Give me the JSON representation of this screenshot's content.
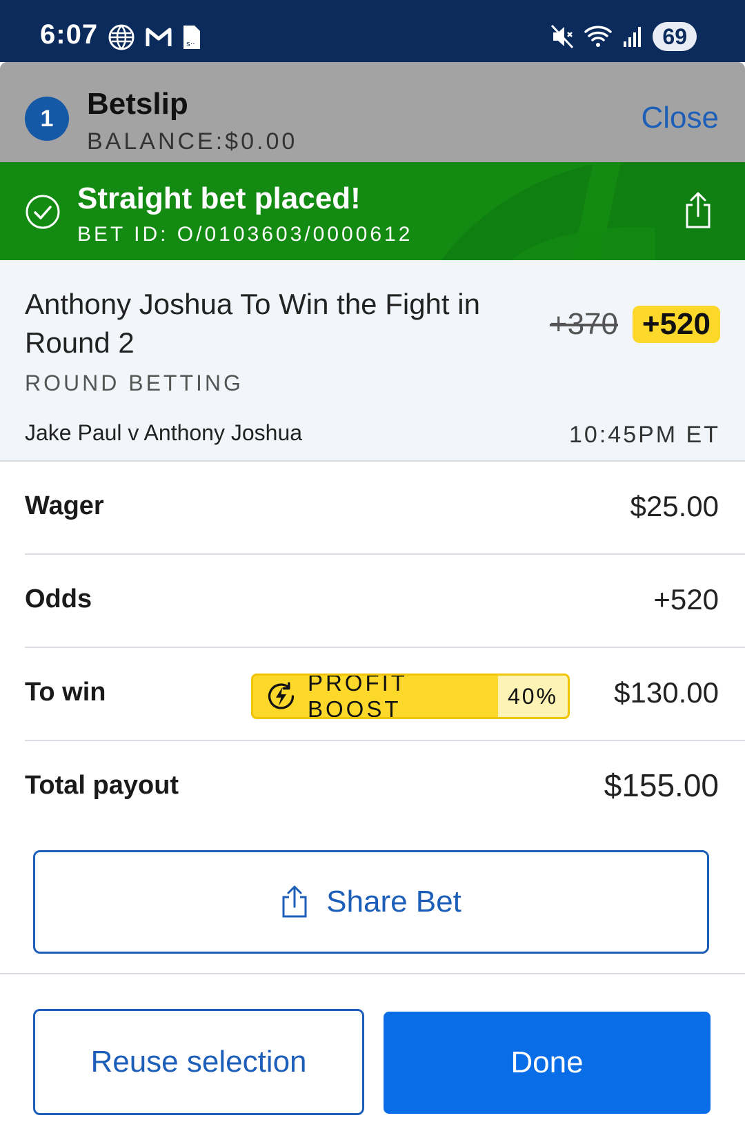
{
  "status_bar": {
    "time": "6:07",
    "battery": "69"
  },
  "header": {
    "count": "1",
    "title": "Betslip",
    "balance": "BALANCE:$0.00",
    "close_label": "Close"
  },
  "banner": {
    "title": "Straight bet placed!",
    "bet_id": "BET ID: O/0103603/0000612"
  },
  "selection": {
    "title": "Anthony Joshua To Win the Fight in Round 2",
    "market": "ROUND BETTING",
    "old_odds": "+370",
    "new_odds": "+520",
    "event": "Jake Paul v Anthony Joshua",
    "time": "10:45PM ET"
  },
  "summary": {
    "wager_label": "Wager",
    "wager_value": "$25.00",
    "odds_label": "Odds",
    "odds_value": "+520",
    "to_win_label": "To win",
    "to_win_value": "$130.00",
    "boost_label": "PROFIT BOOST",
    "boost_pct": "40%",
    "payout_label": "Total payout",
    "payout_value": "$155.00"
  },
  "buttons": {
    "share": "Share Bet",
    "reuse": "Reuse selection",
    "done": "Done"
  },
  "colors": {
    "status_bar": "#0b2b5c",
    "banner": "#138a12",
    "accent": "#1d5fb8",
    "done": "#0a6de8",
    "boost": "#fcd82a"
  },
  "icons": [
    "globe-icon",
    "gmail-icon",
    "sheet-icon",
    "mute-icon",
    "wifi-icon",
    "signal-icon",
    "check-circle-icon",
    "share-icon",
    "boost-icon"
  ]
}
